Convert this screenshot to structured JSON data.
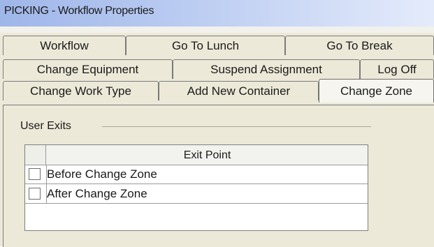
{
  "window": {
    "title": "PICKING - Workflow Properties"
  },
  "tabs": {
    "row1": [
      "Workflow",
      "Go To Lunch",
      "Go To Break"
    ],
    "row2": [
      "Change Equipment",
      "Suspend Assignment",
      "Log Off"
    ],
    "row3": [
      "Change Work Type",
      "Add New Container",
      "Change Zone"
    ],
    "active": "Change Zone"
  },
  "user_exits": {
    "group_label": "User Exits",
    "column_header": "Exit Point",
    "rows": [
      {
        "label": "Before Change Zone",
        "checked": false
      },
      {
        "label": "After Change Zone",
        "checked": false
      }
    ]
  }
}
